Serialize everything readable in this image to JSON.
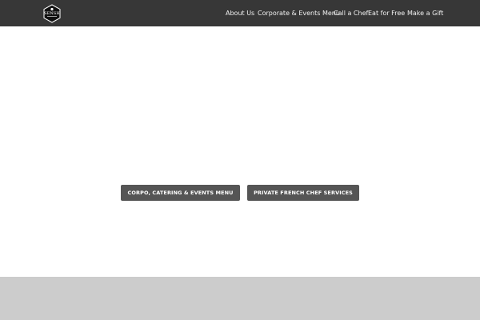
{
  "header": {
    "logo": {
      "text": "SENSH",
      "icon": "hexagon-logo-icon"
    },
    "nav": [
      {
        "label": "About Us"
      },
      {
        "label": "Corporate & Events Menu"
      },
      {
        "label": "Call a Chef"
      },
      {
        "label": "Eat for Free"
      },
      {
        "label": "Make a Gift"
      }
    ]
  },
  "hero": {
    "buttons": [
      {
        "label": "CORPO, CATERING & EVENTS MENU"
      },
      {
        "label": "PRIVATE FRENCH CHEF SERVICES"
      }
    ]
  },
  "colors": {
    "topbar": "#373737",
    "button": "#555555",
    "footer_band": "#cccccc",
    "page_background": "#ffffff"
  }
}
